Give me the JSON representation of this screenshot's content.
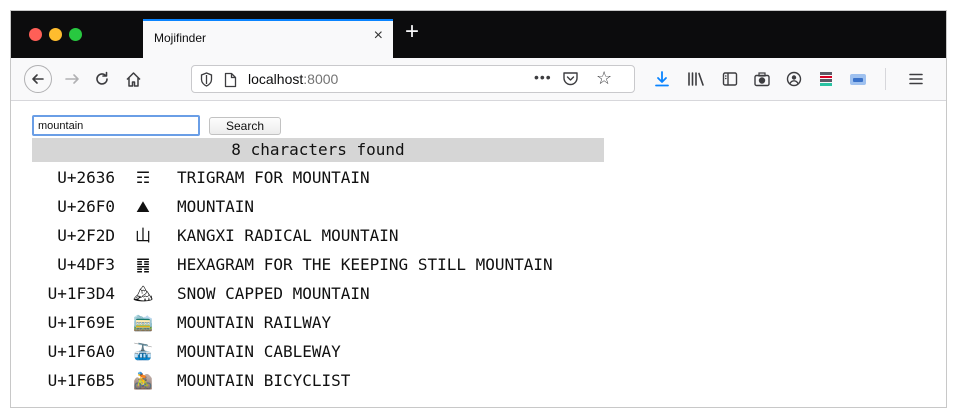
{
  "browser": {
    "tab_title": "Mojifinder",
    "tab_close": "×",
    "new_tab": "+",
    "url_host": "localhost",
    "url_port": ":8000",
    "url_more": "•••",
    "colors": {
      "tabbar": "#0c0c0d",
      "accent": "#0a84ff",
      "download": "#0a84ff"
    },
    "icons": [
      "back-icon",
      "forward-icon",
      "reload-icon",
      "home-icon",
      "shield-icon",
      "page-icon",
      "pocket-icon",
      "star-icon",
      "download-icon",
      "library-icon",
      "sidebar-icon",
      "screenshot-icon",
      "account-icon",
      "extension-icon",
      "menu-icon"
    ]
  },
  "search": {
    "value": "mountain",
    "button_label": "Search"
  },
  "status": "8 characters found",
  "results": [
    {
      "code": "U+2636",
      "char": "☶",
      "name": "TRIGRAM FOR MOUNTAIN"
    },
    {
      "code": "U+26F0",
      "char": "⛰",
      "name": "MOUNTAIN"
    },
    {
      "code": "U+2F2D",
      "char": "⼭",
      "name": "KANGXI RADICAL MOUNTAIN"
    },
    {
      "code": "U+4DF3",
      "char": "䷳",
      "name": "HEXAGRAM FOR THE KEEPING STILL MOUNTAIN"
    },
    {
      "code": "U+1F3D4",
      "char": "🏔",
      "name": "SNOW CAPPED MOUNTAIN"
    },
    {
      "code": "U+1F69E",
      "char": "🚞",
      "name": "MOUNTAIN RAILWAY"
    },
    {
      "code": "U+1F6A0",
      "char": "🚠",
      "name": "MOUNTAIN CABLEWAY"
    },
    {
      "code": "U+1F6B5",
      "char": "🚵",
      "name": "MOUNTAIN BICYCLIST"
    }
  ]
}
